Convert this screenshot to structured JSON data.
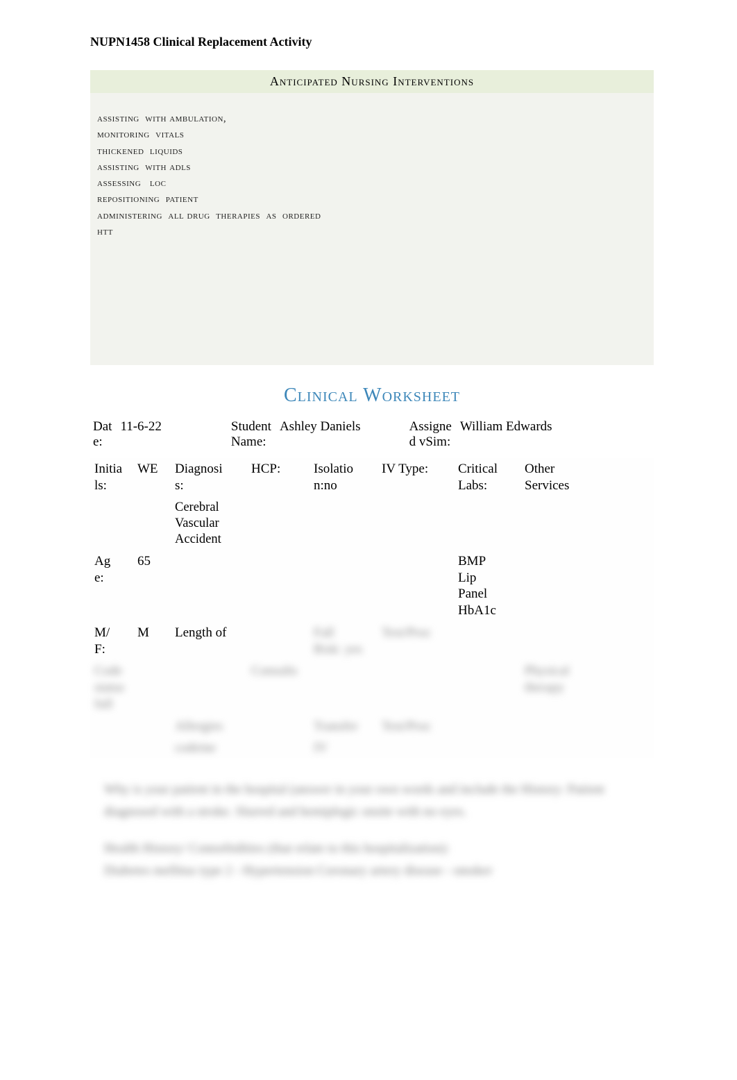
{
  "course_header": "NUPN1458 Clinical Replacement Activity",
  "ani": {
    "title": "Anticipated   Nursing  Interventions",
    "lines": [
      "assisting  with ambulation,",
      "monitoring  vitals",
      "thickened  liquids",
      "assisting  with adls",
      "assessing   loc",
      "repositioning  patient",
      "administering  all drug  therapies  as  ordered",
      "htt"
    ]
  },
  "worksheet_title": "Clinical  Worksheet",
  "row1": {
    "date_label": "Dat\ne:",
    "date_value": "11-6-22",
    "student_label": "Student\nName:",
    "student_value": "Ashley Daniels",
    "assigned_label": "Assigne\nd vSim:",
    "assigned_value": "William Edwards"
  },
  "grid": {
    "initials_label": "Initia\nls:",
    "initials_value": "WE",
    "diagnosis_label": "Diagnosi\ns:",
    "diagnosis_value": "Cerebral\nVascular\nAccident",
    "hcp_label": "HCP:",
    "hcp_value": "",
    "isolation_label": "Isolatio\nn:no",
    "ivtype_label": "IV Type:",
    "ivtype_value": "",
    "critical_label": "Critical\nLabs:",
    "critical_value": "BMP\nLip\nPanel\nHbA1c",
    "other_label": "Other\nServices",
    "age_label": "Ag\ne:",
    "age_value": "65",
    "mf_label": "M/\nF:",
    "mf_value": "M",
    "length_label": "Length of"
  },
  "blur": {
    "b1": "Code",
    "b2": "status",
    "b3": "full",
    "b4": "Allergies",
    "b5": "codeine",
    "b6": "Consults",
    "b7": "IV",
    "b8": "Fall",
    "b9": "Risk: yes",
    "b10": "Transfer",
    "b11": "Test/Proc",
    "b12": "Consults",
    "b13": "Physical",
    "b14": "therapy",
    "para1": "Why is your patient in the hospital (answer in your own words and include the History: Patient diagnosed with a stroke. Slurred and hemiplegic onsite with no eyes.",
    "para2": "Health History/ Comorbidities (that relate to this hospitalization):",
    "para3": "Diabetes mellitus type 2 - Hypertension                    Coronary artery disease - smoker"
  }
}
